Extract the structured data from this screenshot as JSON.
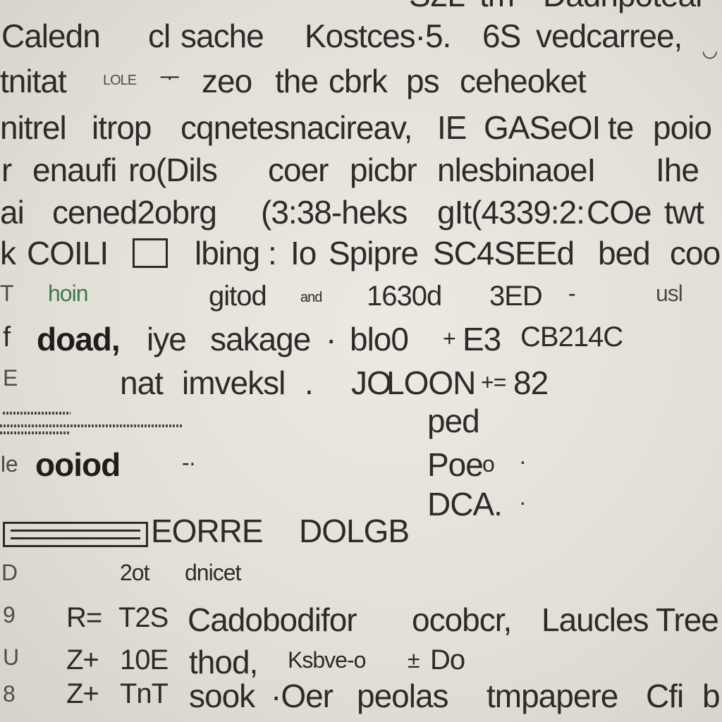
{
  "document": {
    "lines": [
      {
        "items": [
          "Caledn",
          "cl",
          "sache",
          "Kostces·5.",
          "6S",
          "vedcarree,"
        ]
      },
      {
        "items": [
          "tnitat",
          "LOLE",
          "ᅮ",
          "zeo",
          "the",
          "cbrk",
          "ps",
          "ceheoket"
        ]
      },
      {
        "items": [
          "nitrel",
          "itrop",
          "cqnetesnacireav,",
          "IE",
          "GASeOI",
          "te",
          "poio"
        ]
      },
      {
        "items": [
          "r",
          "enaufi",
          "ro(Dils",
          "coer",
          "picbr",
          "nlesbinaoeI",
          "Ihe"
        ]
      },
      {
        "items": [
          "ai",
          "cened2obrg",
          "(3:38-heks",
          "gIt(4339:2:",
          "COe",
          "twt"
        ]
      },
      {
        "items": [
          "k",
          "COILI",
          "D",
          "lbing",
          ":",
          "Io",
          "Spipre",
          "SC4SEEd",
          "bed",
          "coo"
        ]
      },
      {
        "items": [
          "T",
          "hoin",
          "gitod",
          "and",
          "1630d",
          "3ED",
          "-",
          "usl"
        ]
      },
      {
        "items": [
          "f",
          "doad,",
          "iye",
          "sakage",
          "·",
          "blo0",
          "+",
          "E3",
          "CB214C"
        ]
      },
      {
        "items": [
          "E",
          "nat",
          "imveksl",
          ".",
          "JO",
          "LOON",
          "+=",
          "82"
        ]
      },
      {
        "items": [
          "ped"
        ]
      },
      {
        "items": [
          "Ie",
          "ooiod",
          "-·",
          "Poe",
          "o",
          "·"
        ]
      },
      {
        "items": [
          "DCA.",
          "·"
        ]
      },
      {
        "items": [
          "EORRE",
          "DOLGB"
        ]
      },
      {
        "items": [
          "D",
          "2ot",
          "dnicet"
        ]
      },
      {
        "items": [
          "9",
          "R=",
          "T2S",
          "Cadobodifor",
          "ocobcr,",
          "Laucles",
          "Tree"
        ]
      },
      {
        "items": [
          "U",
          "Z+",
          "10E",
          "thod,",
          "Ksbve-o",
          "±",
          "Do"
        ]
      },
      {
        "items": [
          "8",
          "Z+",
          "TnT",
          "sook",
          "·Oer",
          "peolas",
          "tmpapere",
          "Cfi",
          "b"
        ]
      }
    ],
    "top_partial": [
      "S2L",
      "tm",
      "Dadnpoteal"
    ]
  },
  "colors": {
    "paper": "#e3e0d8",
    "ink": "#2c2b28",
    "accent_green": "#3f7a4a"
  }
}
